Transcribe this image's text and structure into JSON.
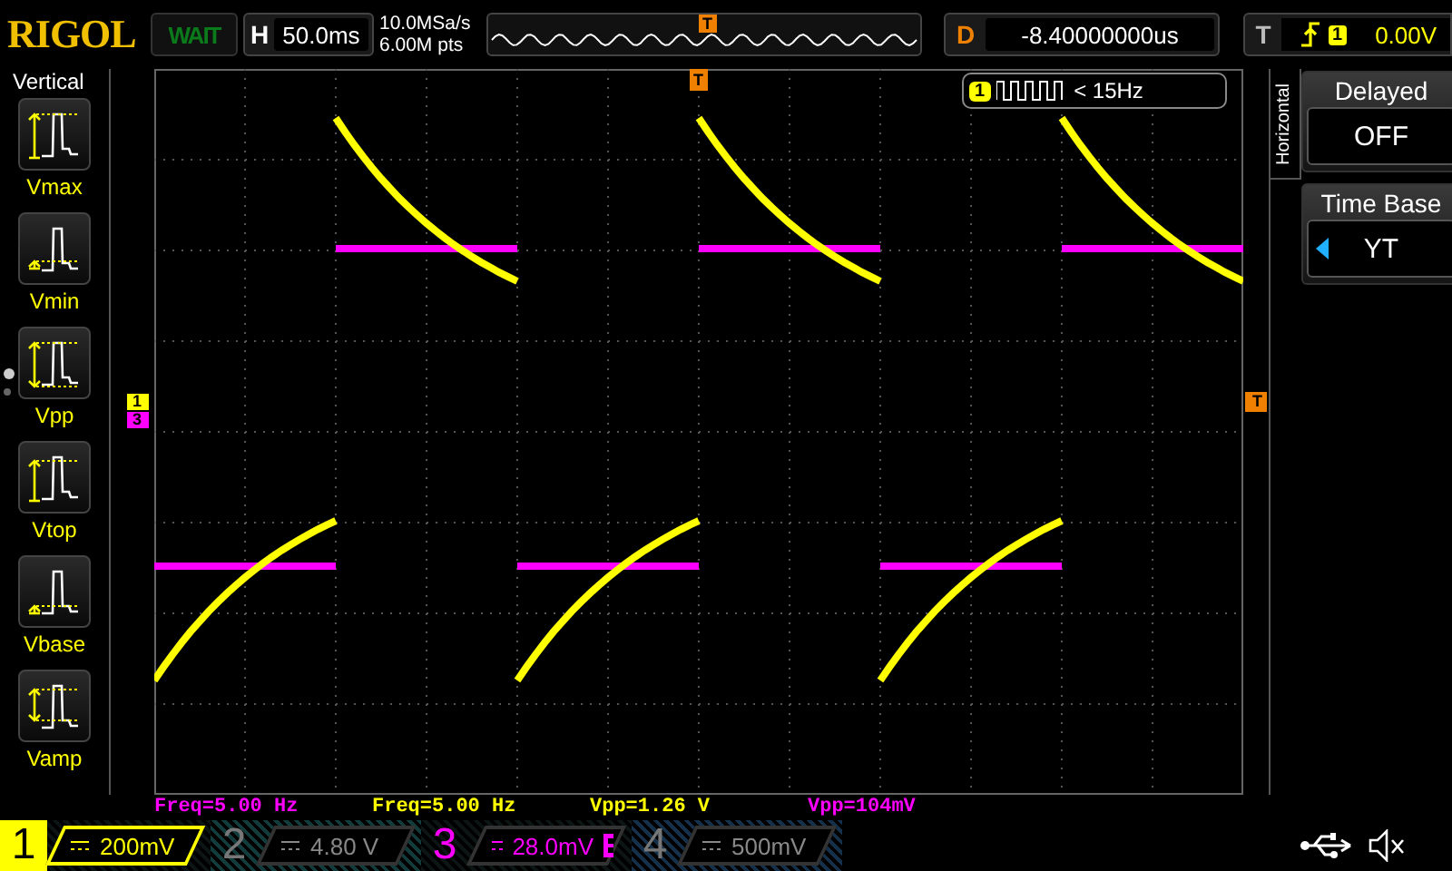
{
  "header": {
    "logo": "RIGOL",
    "run_status": "WAIT",
    "timebase": {
      "label": "H",
      "value": "50.0ms"
    },
    "sample_rate": "10.0MSa/s",
    "memory_depth": "6.00M pts",
    "overview_marker": "T",
    "delay": {
      "label": "D",
      "value": "-8.40000000us"
    },
    "trigger": {
      "label": "T",
      "channel": "1",
      "level": "0.00V"
    }
  },
  "sidebar": {
    "title": "Vertical",
    "items": [
      {
        "label": "Vmax",
        "kind": "vmax"
      },
      {
        "label": "Vmin",
        "kind": "vmin"
      },
      {
        "label": "Vpp",
        "kind": "vpp"
      },
      {
        "label": "Vtop",
        "kind": "vtop"
      },
      {
        "label": "Vbase",
        "kind": "vbase"
      },
      {
        "label": "Vamp",
        "kind": "vamp"
      }
    ],
    "pages": [
      {
        "selected": true
      },
      {
        "selected": false
      }
    ]
  },
  "screen": {
    "trigger_position_marker": "T",
    "trigger_level_marker": "T",
    "channel_markers": [
      {
        "label": "1",
        "color": "#ffff00"
      },
      {
        "label": "3",
        "color": "#ff00ff"
      }
    ],
    "frequency_counter": {
      "channel": "1",
      "value": "< 15Hz"
    }
  },
  "menu": {
    "title": "Horizontal",
    "items": [
      {
        "title": "Delayed",
        "value": "OFF",
        "arrow": false
      },
      {
        "title": "Time Base",
        "value": "YT",
        "arrow": true
      }
    ]
  },
  "measurements": [
    {
      "text": "Freq=5.00 Hz",
      "color": "#ff00ff"
    },
    {
      "text": "Freq=5.00 Hz",
      "color": "#ffff00"
    },
    {
      "text": "Vpp=1.26 V",
      "color": "#ffff00"
    },
    {
      "text": "Vpp=104mV",
      "color": "#ff00ff"
    }
  ],
  "channels": [
    {
      "number": "1",
      "scale": "200mV",
      "on": true,
      "selected": true,
      "bandwidth_limit": false,
      "color": "#ffff00"
    },
    {
      "number": "2",
      "scale": "4.80 V",
      "on": false,
      "selected": false,
      "bandwidth_limit": false,
      "color": "#123c3c"
    },
    {
      "number": "3",
      "scale": "28.0mV",
      "on": true,
      "selected": false,
      "bandwidth_limit": true,
      "color": "#ff00ff"
    },
    {
      "number": "4",
      "scale": "500mV",
      "on": false,
      "selected": false,
      "bandwidth_limit": false,
      "color": "#14304a"
    }
  ]
}
